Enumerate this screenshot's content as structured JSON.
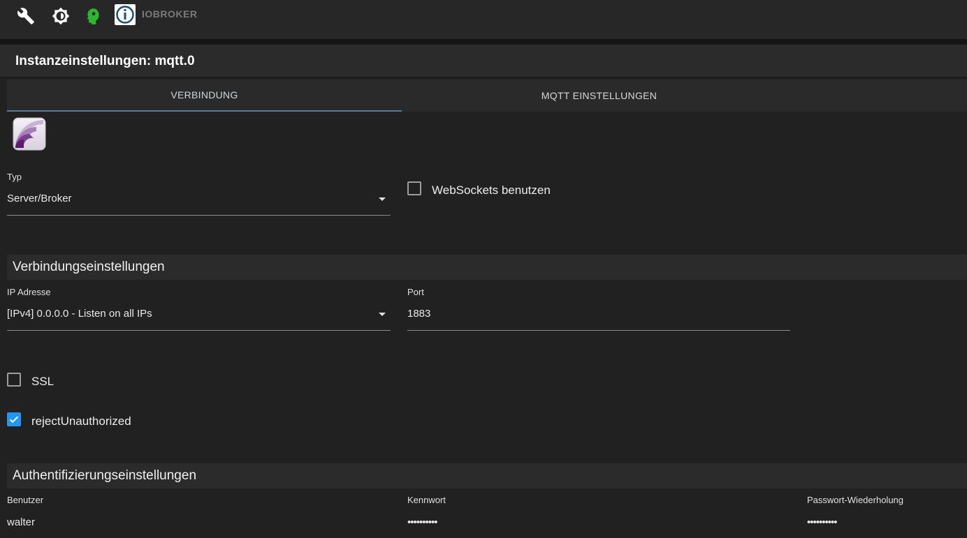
{
  "topbar": {
    "icons": [
      "wrench-icon",
      "brightness-icon",
      "expert-mode-icon"
    ],
    "brand": "IOBROKER",
    "colors": {
      "expert": "#2fb52f",
      "logo": "#1b4d7a"
    }
  },
  "title": "Instanzeinstellungen: mqtt.0",
  "tabs": [
    {
      "label": "VERBINDUNG",
      "active": true
    },
    {
      "label": "MQTT EINSTELLUNGEN",
      "active": false
    }
  ],
  "type_field": {
    "label": "Typ",
    "value": "Server/Broker"
  },
  "websockets": {
    "label": "WebSockets benutzen",
    "checked": false
  },
  "connection_section": {
    "title": "Verbindungseinstellungen",
    "ip": {
      "label": "IP Adresse",
      "value": "[IPv4] 0.0.0.0 - Listen on all IPs"
    },
    "port": {
      "label": "Port",
      "value": "1883"
    },
    "ssl": {
      "label": "SSL",
      "checked": false
    },
    "reject": {
      "label": "rejectUnauthorized",
      "checked": true
    }
  },
  "auth_section": {
    "title": "Authentifizierungseinstellungen",
    "user": {
      "label": "Benutzer",
      "value": "walter"
    },
    "password": {
      "label": "Kennwort",
      "value": "••••••••••"
    },
    "password_repeat": {
      "label": "Passwort-Wiederholung",
      "value": "••••••••••"
    }
  }
}
